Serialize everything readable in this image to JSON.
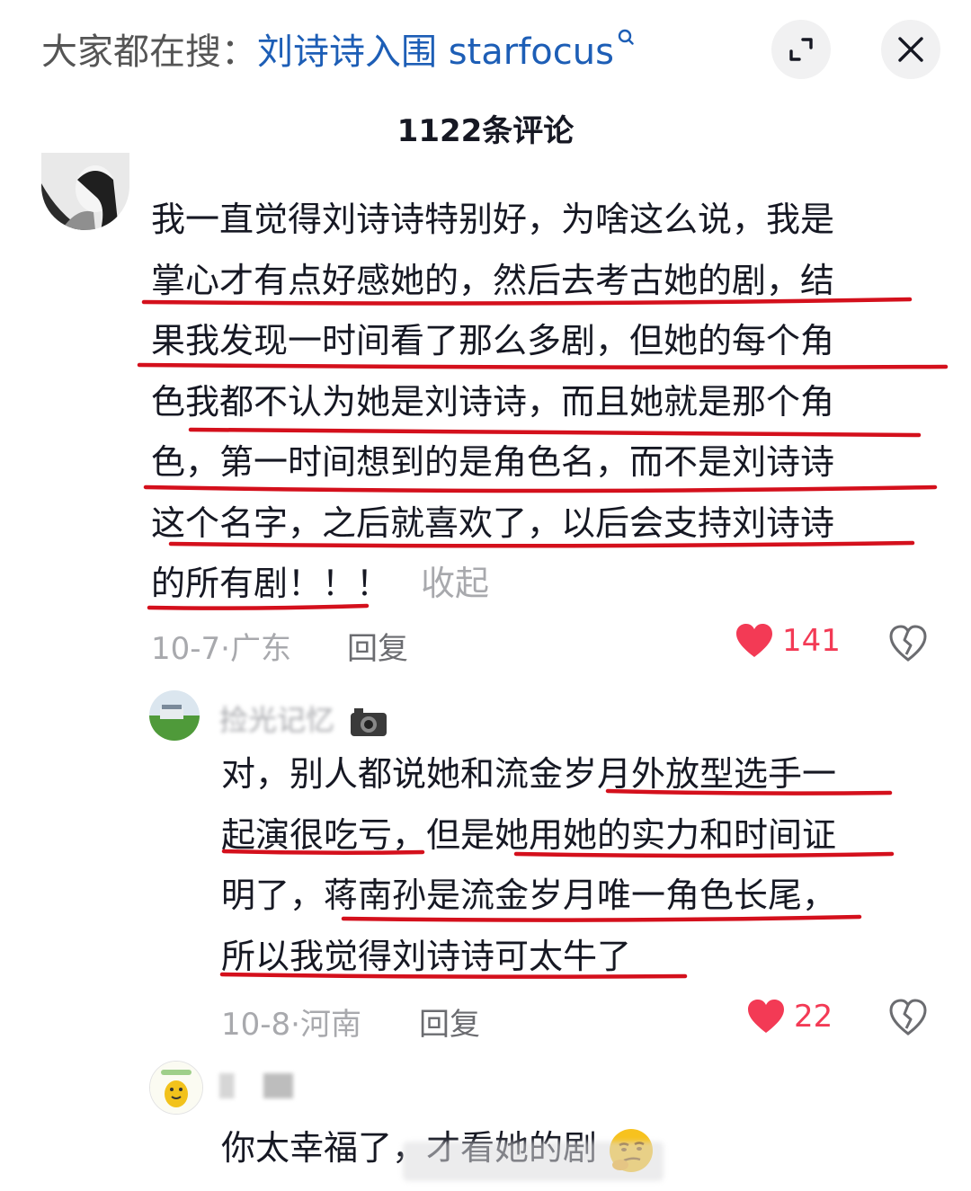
{
  "header": {
    "search_prefix": "大家都在搜：",
    "search_term": "刘诗诗入围 starfocus",
    "comment_count": "1122条评论"
  },
  "comments": [
    {
      "lines": [
        "我一直觉得刘诗诗特别好，为啥这么说，我是",
        "掌心才有点好感她的，然后去考古她的剧，结",
        "果我发现一时间看了那么多剧，但她的每个角",
        "色我都不认为她是刘诗诗，而且她就是那个角",
        "色，第一时间想到的是角色名，而不是刘诗诗",
        "这个名字，之后就喜欢了，以后会支持刘诗诗",
        "的所有剧！！！"
      ],
      "collapse": "收起",
      "date": "10-7",
      "location": "广东",
      "reply": "回复",
      "likes": "141"
    }
  ],
  "replies": [
    {
      "username": "捡光记忆",
      "lines": [
        "对，别人都说她和流金岁月外放型选手一",
        "起演很吃亏，但是她用她的实力和时间证",
        "明了，蒋南孙是流金岁月唯一角色长尾，",
        "所以我觉得刘诗诗可太牛了"
      ],
      "date": "10-8",
      "location": "河南",
      "reply": "回复",
      "likes": "22"
    },
    {
      "username": "",
      "text": "你太幸福了，才看她的剧"
    }
  ],
  "colors": {
    "link": "#1d5eb6",
    "like": "#f33a55",
    "underline": "#d4101c",
    "meta": "#a8a9ad"
  },
  "icons": [
    "search-icon",
    "expand-icon",
    "close-icon",
    "heart-icon",
    "broken-heart-icon",
    "camera-emoji",
    "smirk-emoji"
  ]
}
